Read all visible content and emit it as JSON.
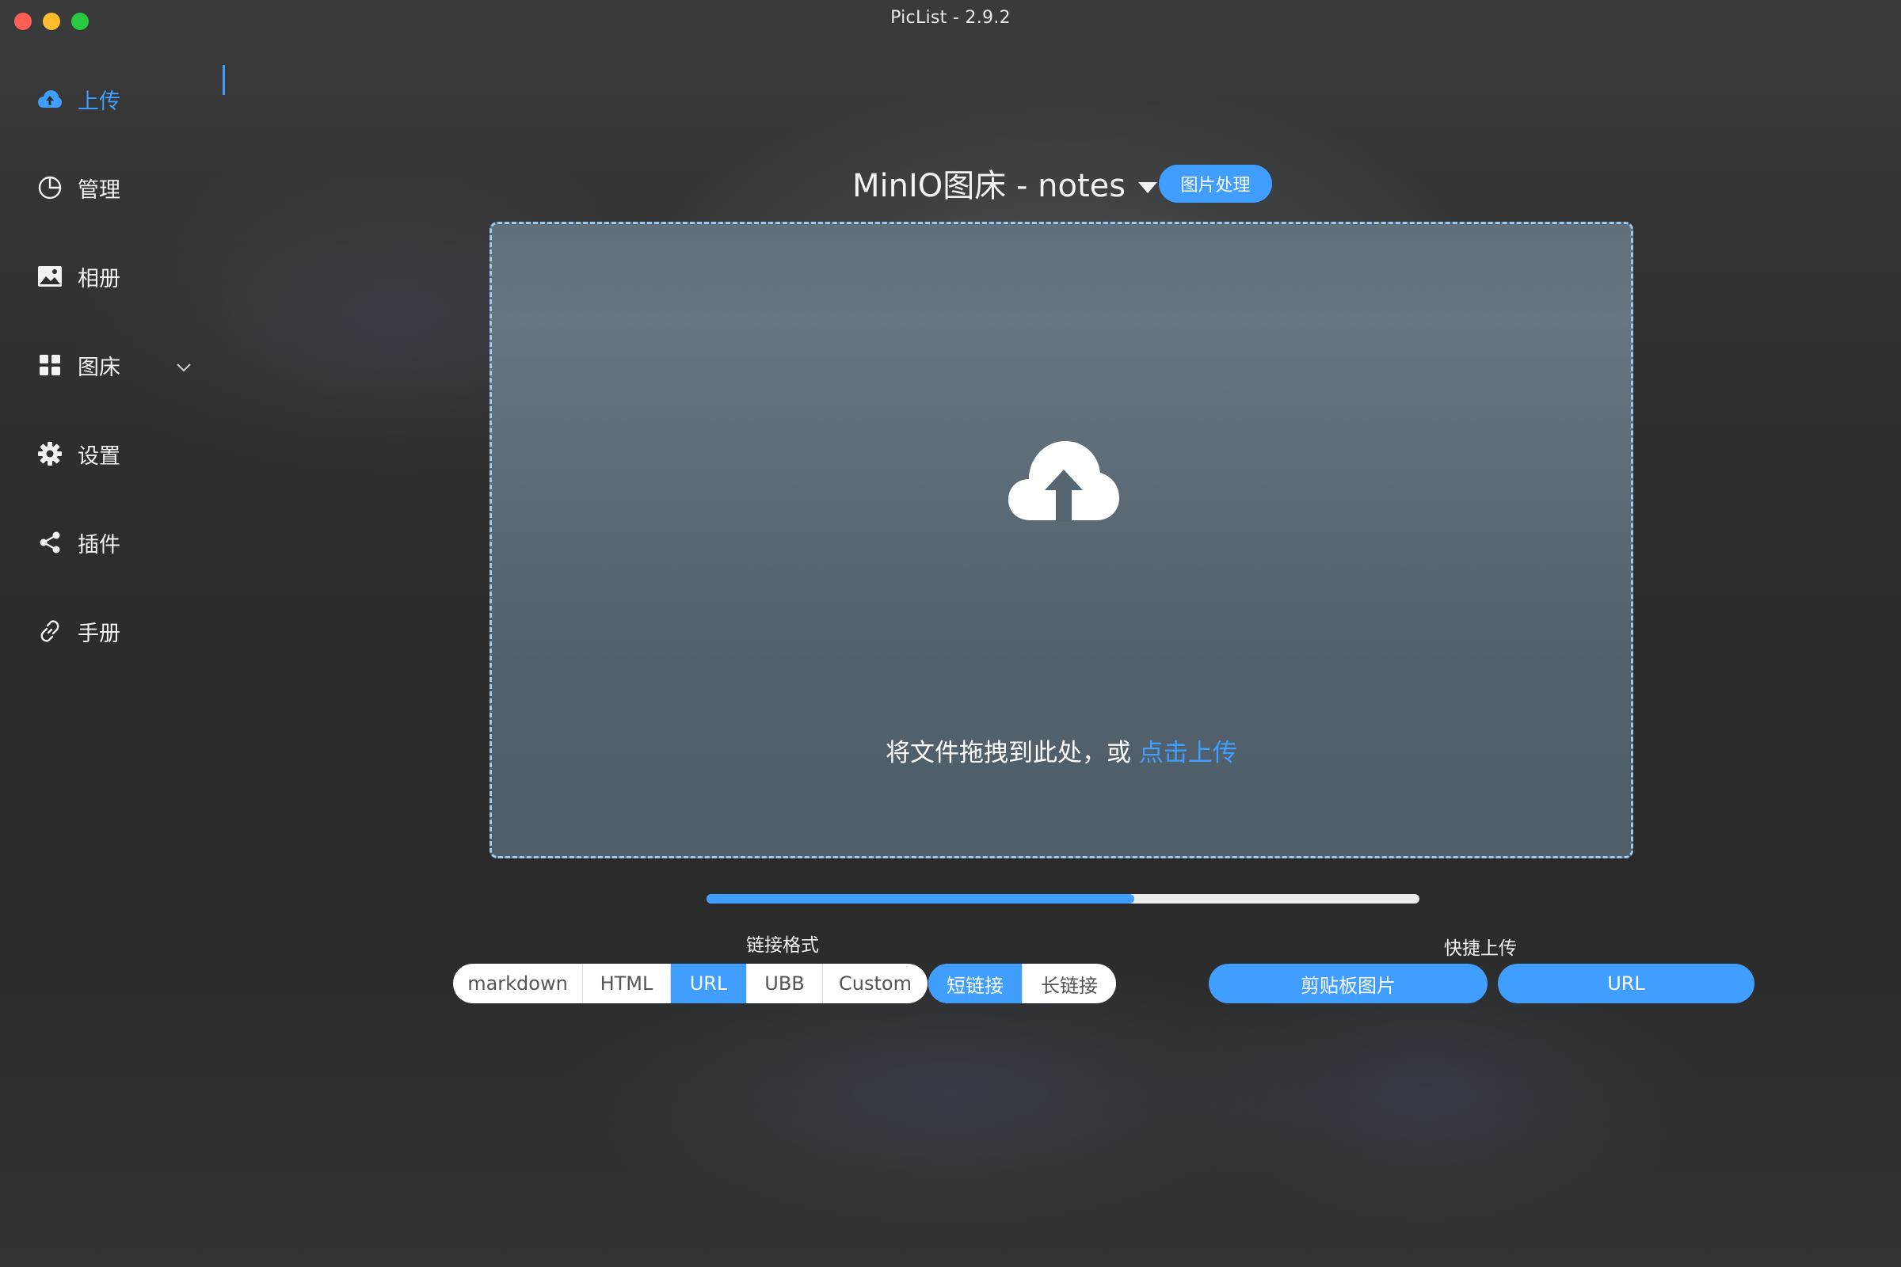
{
  "window": {
    "title": "PicList - 2.9.2"
  },
  "sidebar": {
    "items": [
      {
        "label": "上传",
        "icon": "cloud-upload-icon",
        "active": true
      },
      {
        "label": "管理",
        "icon": "pie-chart-icon"
      },
      {
        "label": "相册",
        "icon": "image-icon"
      },
      {
        "label": "图床",
        "icon": "grid-icon",
        "expandable": true
      },
      {
        "label": "设置",
        "icon": "gear-icon"
      },
      {
        "label": "插件",
        "icon": "share-icon"
      },
      {
        "label": "手册",
        "icon": "link-icon"
      }
    ]
  },
  "upload": {
    "picbed_title": "MinIO图床 - notes",
    "process_button": "图片处理",
    "drop_text": "将文件拖拽到此处，或",
    "drop_link": "点击上传",
    "progress": 0.6
  },
  "link_format": {
    "label": "链接格式",
    "options": [
      "markdown",
      "HTML",
      "URL",
      "UBB",
      "Custom"
    ],
    "selected": "URL",
    "length_options": [
      "短链接",
      "长链接"
    ],
    "length_selected": "短链接"
  },
  "quick_upload": {
    "label": "快捷上传",
    "clipboard_button": "剪贴板图片",
    "url_button": "URL"
  },
  "colors": {
    "accent": "#409eff",
    "dashed_border": "#9ec9ef"
  }
}
